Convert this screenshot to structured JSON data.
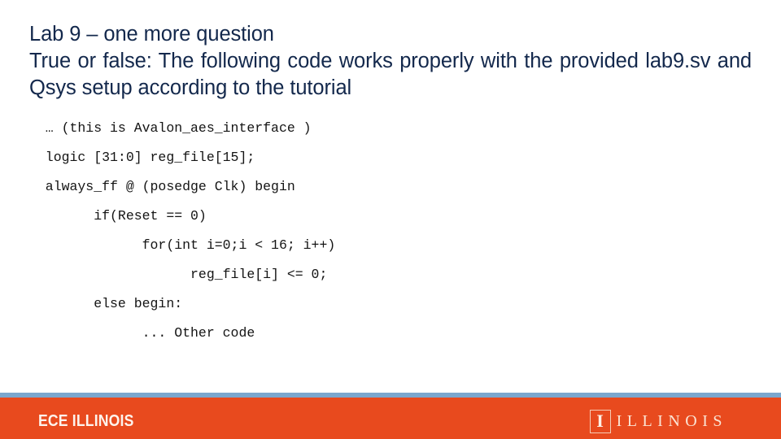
{
  "slide": {
    "title": "Lab 9 – one more question",
    "question": "True or false: The following code works properly with the provided lab9.sv and Qsys setup according to the tutorial",
    "code_lines": [
      "  … (this is Avalon_aes_interface )",
      "  logic [31:0] reg_file[15];",
      "  always_ff @ (posedge Clk) begin",
      "        if(Reset == 0)",
      "              for(int i=0;i < 16; i++)",
      "                    reg_file[i] <= 0;",
      "        else begin:",
      "              ... Other code"
    ]
  },
  "footer": {
    "ece_logo_text": "ECE ILLINOIS",
    "block_i_glyph": "I",
    "illinois_wordmark": "ILLINOIS",
    "accent_rule_color": "#7ba7ce",
    "bar_color": "#e84a1e",
    "logo_text_color": "#fdf3ec"
  },
  "colors": {
    "title_text": "#13284c",
    "code_text": "#141414",
    "background": "#ffffff"
  }
}
